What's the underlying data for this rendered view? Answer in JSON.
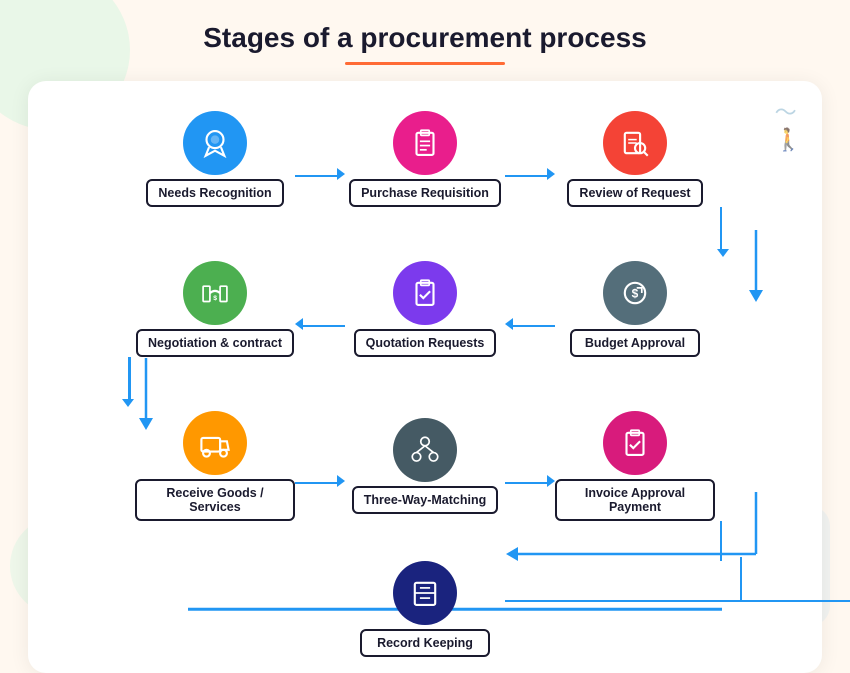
{
  "page": {
    "title": "Stages of a procurement process",
    "bg_color": "#fff8f0"
  },
  "nodes": {
    "needs_recognition": {
      "label": "Needs Recognition",
      "color": "#2196f3"
    },
    "purchase_requisition": {
      "label": "Purchase Requisition",
      "color": "#e91e8c"
    },
    "review_of_request": {
      "label": "Review of Request",
      "color": "#f44336"
    },
    "negotiation_contract": {
      "label": "Negotiation & contract",
      "color": "#4caf50"
    },
    "quotation_requests": {
      "label": "Quotation Requests",
      "color": "#7c3aed"
    },
    "budget_approval": {
      "label": "Budget Approval",
      "color": "#546e7a"
    },
    "receive_goods": {
      "label": "Receive Goods / Services",
      "color": "#ff9800"
    },
    "three_way_matching": {
      "label": "Three-Way-Matching",
      "color": "#455a64"
    },
    "invoice_approval": {
      "label": "Invoice Approval Payment",
      "color": "#d81b7c"
    },
    "record_keeping": {
      "label": "Record Keeping",
      "color": "#1a237e"
    }
  },
  "arrows": {
    "right": "→",
    "left": "←",
    "down": "↓"
  },
  "decorations": {
    "squiggle": "〜",
    "cross": "✕",
    "wave": "〜〜"
  }
}
